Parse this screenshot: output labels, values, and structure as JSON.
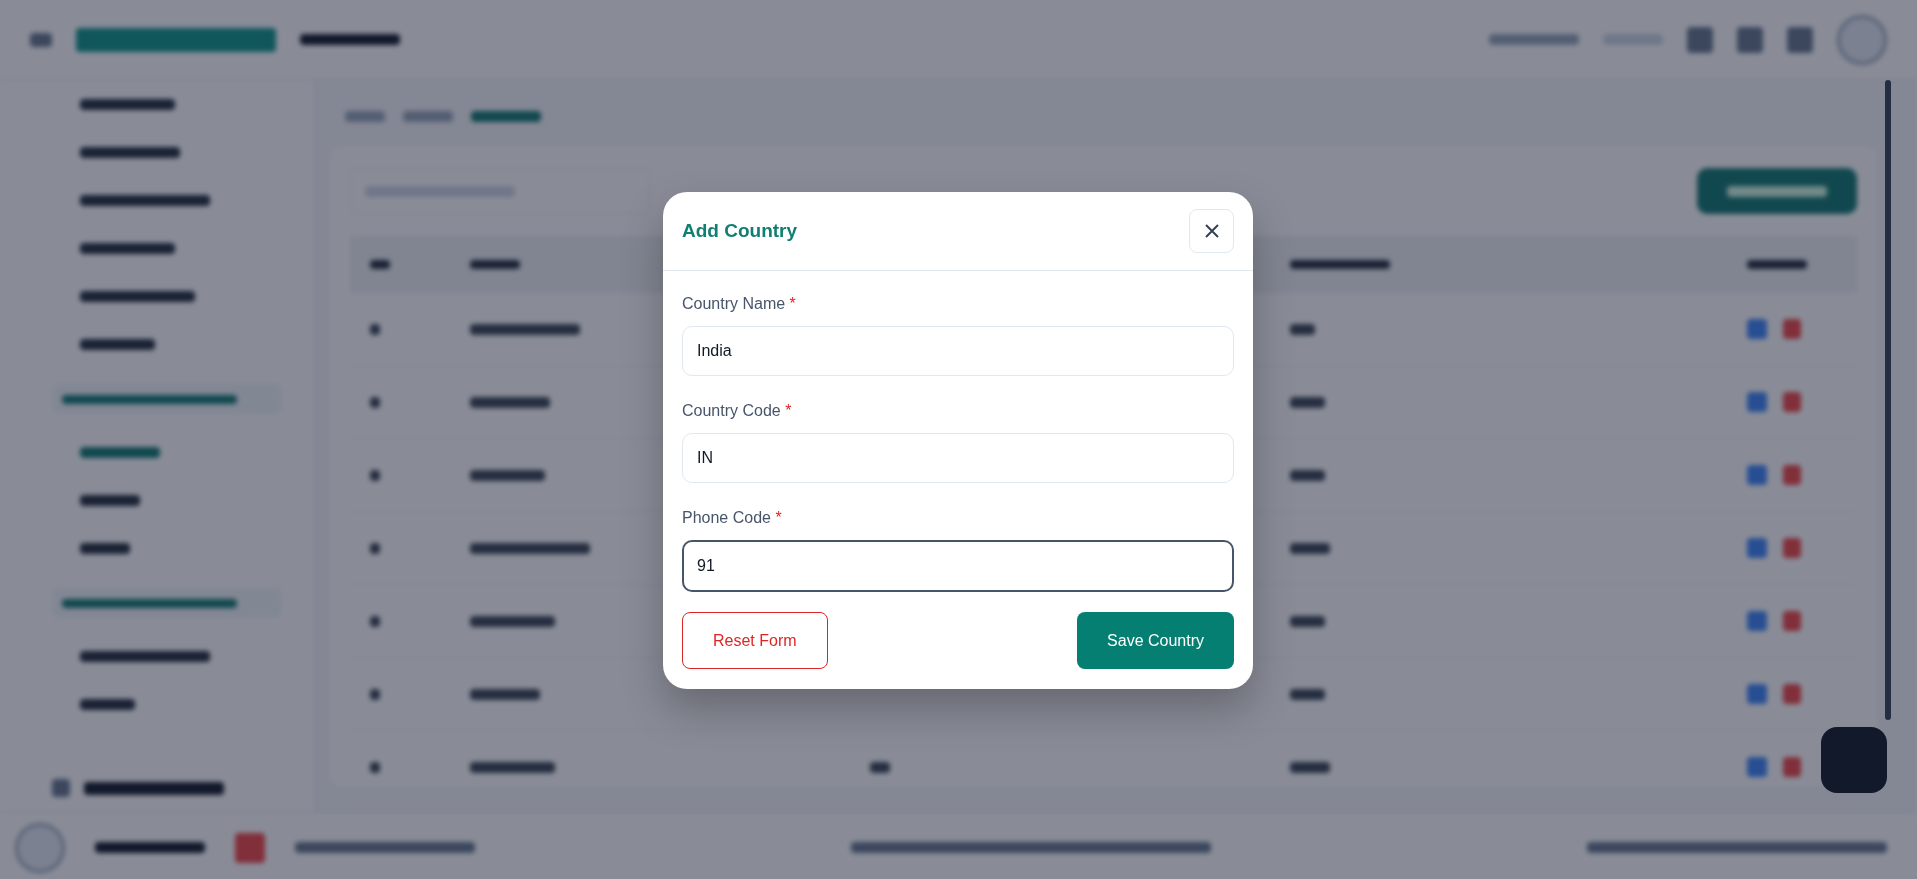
{
  "modal": {
    "title": "Add Country",
    "fields": [
      {
        "label": "Country Name",
        "required_mark": "*",
        "value": "India",
        "focused": false
      },
      {
        "label": "Country Code",
        "required_mark": "*",
        "value": "IN",
        "focused": false
      },
      {
        "label": "Phone Code",
        "required_mark": "*",
        "value": "91",
        "focused": true
      }
    ],
    "buttons": [
      {
        "label": "Reset Form",
        "kind": "outline"
      },
      {
        "label": "Save Country",
        "kind": "primary"
      }
    ]
  }
}
